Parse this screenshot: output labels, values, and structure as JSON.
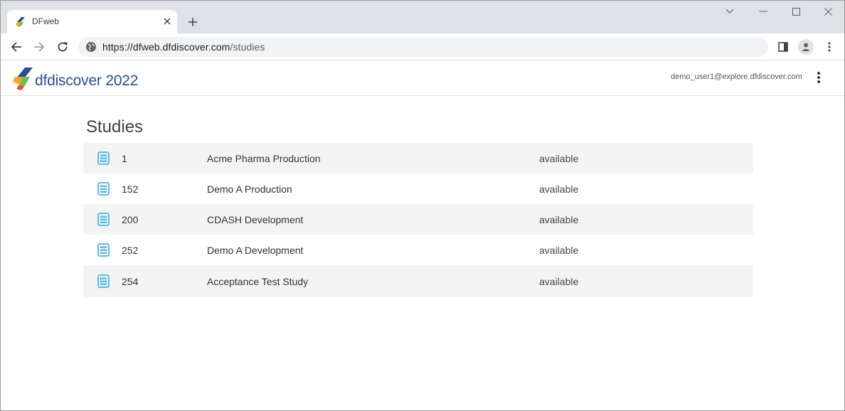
{
  "browser": {
    "tab_title": "DFweb",
    "url_host": "https://dfweb.dfdiscover.com",
    "url_path": "/studies"
  },
  "app": {
    "logo_text": "dfdiscover 2022",
    "user_email": "demo_user1@explore.dfdiscover.com"
  },
  "main": {
    "title": "Studies",
    "studies": [
      {
        "id": "1",
        "name": "Acme Pharma Production",
        "status": "available"
      },
      {
        "id": "152",
        "name": "Demo A Production",
        "status": "available"
      },
      {
        "id": "200",
        "name": "CDASH Development",
        "status": "available"
      },
      {
        "id": "252",
        "name": "Demo A Development",
        "status": "available"
      },
      {
        "id": "254",
        "name": "Acceptance Test Study",
        "status": "available"
      }
    ]
  },
  "colors": {
    "accent": "#5bbde4",
    "logo_blue": "#2a4f8f",
    "row_alt": "#f4f4f4"
  },
  "icons": {
    "study_row": "list-icon",
    "logo": "dfdiscover-logo-icon"
  }
}
